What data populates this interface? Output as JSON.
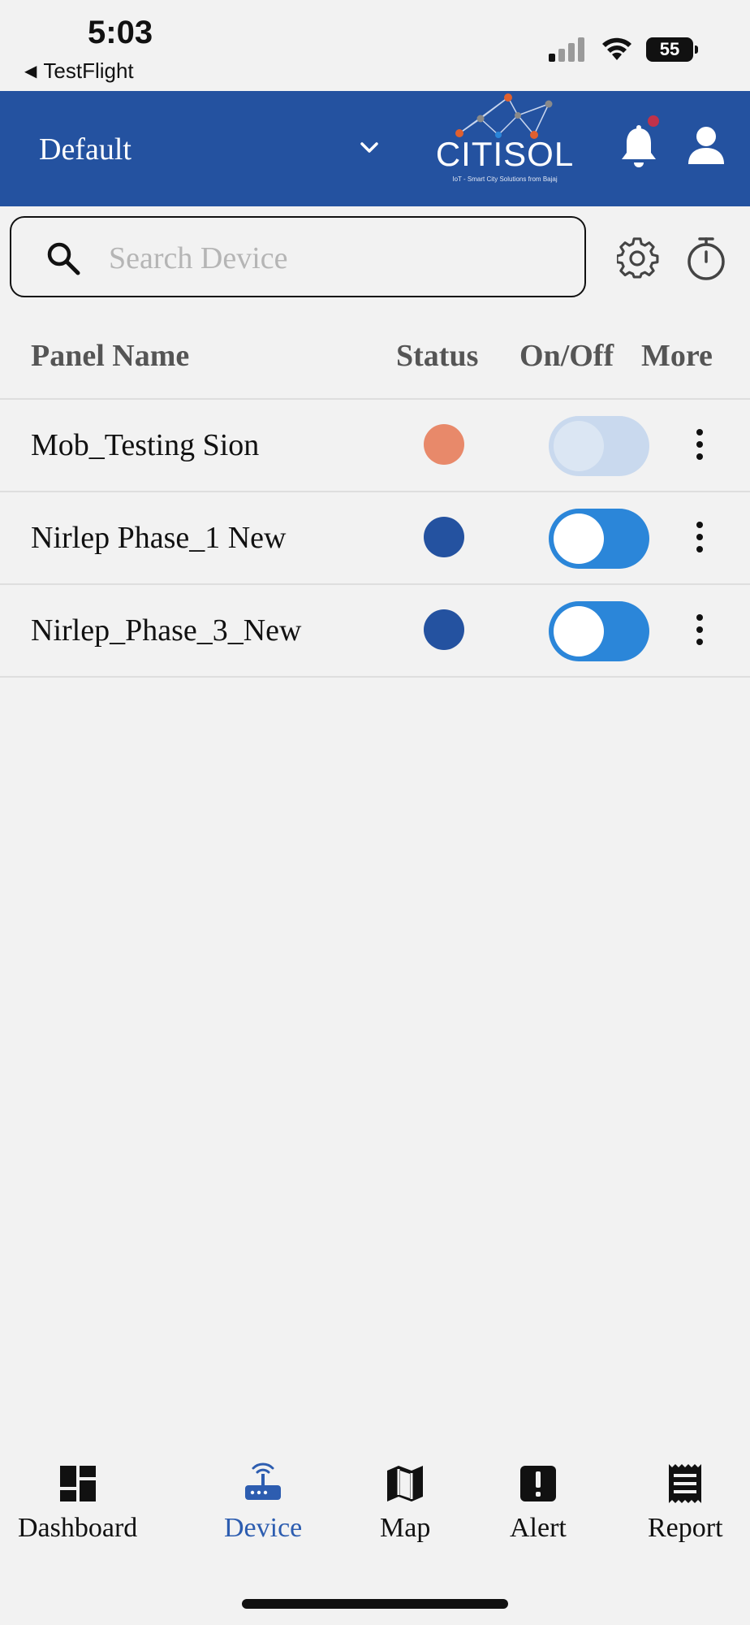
{
  "status_bar": {
    "time": "5:03",
    "back_app": "TestFlight",
    "battery": "55"
  },
  "header": {
    "group_selector": "Default",
    "logo_text": "CITISOL",
    "logo_tagline": "IoT - Smart City Solutions from Bajaj",
    "brand_color": "#2452a0"
  },
  "search": {
    "placeholder": "Search Device",
    "value": ""
  },
  "table": {
    "columns": [
      "Panel Name",
      "Status",
      "On/Off",
      "More"
    ],
    "rows": [
      {
        "name": "Mob_Testing Sion",
        "status_color": "#e8896a",
        "toggle_state": "off",
        "toggle_enabled": false
      },
      {
        "name": "Nirlep Phase_1 New",
        "status_color": "#2452a0",
        "toggle_state": "off",
        "toggle_enabled": true
      },
      {
        "name": "Nirlep_Phase_3_New",
        "status_color": "#2452a0",
        "toggle_state": "off",
        "toggle_enabled": true
      }
    ]
  },
  "bottom_nav": {
    "items": [
      {
        "label": "Dashboard",
        "icon": "dashboard-icon",
        "active": false
      },
      {
        "label": "Device",
        "icon": "router-icon",
        "active": true
      },
      {
        "label": "Map",
        "icon": "map-icon",
        "active": false
      },
      {
        "label": "Alert",
        "icon": "alert-icon",
        "active": false
      },
      {
        "label": "Report",
        "icon": "report-icon",
        "active": false
      }
    ],
    "active_color": "#2d5db0"
  }
}
